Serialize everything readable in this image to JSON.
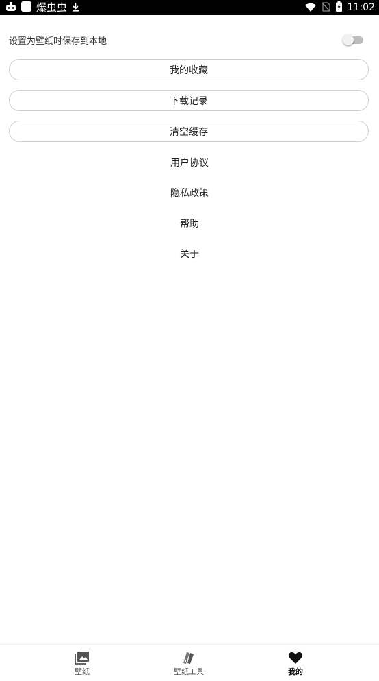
{
  "status_bar": {
    "left_text": "爆虫虫",
    "time": "11:02",
    "icons": [
      "game-controller-icon",
      "app-square-icon",
      "download-icon",
      "wifi-icon",
      "no-sim-icon",
      "battery-charging-icon"
    ]
  },
  "settings": {
    "save_wallpaper_label": "设置为壁纸时保存到本地",
    "save_wallpaper_enabled": false
  },
  "menu": {
    "favorites": "我的收藏",
    "downloads": "下载记录",
    "clear_cache": "清空缓存",
    "user_agreement": "用户协议",
    "privacy_policy": "隐私政策",
    "help": "帮助",
    "about": "关于"
  },
  "bottom_nav": {
    "wallpaper": "壁纸",
    "wallpaper_tools": "壁纸工具",
    "mine": "我的",
    "active": "mine"
  },
  "colors": {
    "status_bar_bg": "#000000",
    "button_border": "#cfcfcf",
    "text": "#222222"
  }
}
